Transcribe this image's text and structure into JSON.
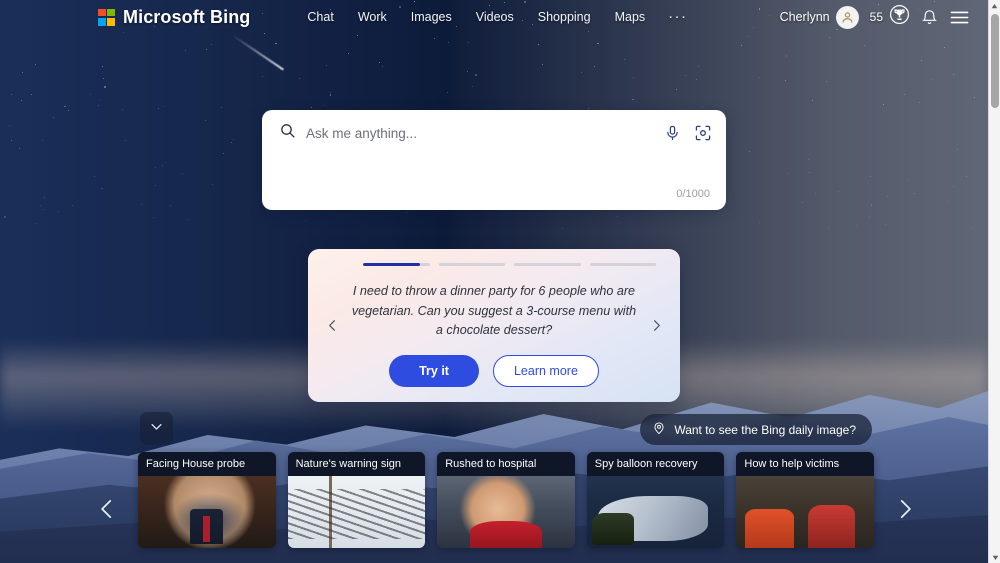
{
  "header": {
    "brand": "Microsoft Bing",
    "brand_logo_icon": "microsoft-logo-icon",
    "nav": [
      {
        "label": "Chat"
      },
      {
        "label": "Work"
      },
      {
        "label": "Images"
      },
      {
        "label": "Videos"
      },
      {
        "label": "Shopping"
      },
      {
        "label": "Maps"
      }
    ],
    "more_label": "···",
    "user_name": "Cherlynn",
    "avatar_icon": "user-avatar-icon",
    "rewards_count": "55",
    "rewards_icon": "trophy-icon",
    "notifications_icon": "bell-icon",
    "menu_icon": "hamburger-menu-icon"
  },
  "search": {
    "placeholder": "Ask me anything...",
    "value": "",
    "search_icon": "search-icon",
    "mic_icon": "microphone-icon",
    "visual_search_icon": "visual-search-icon",
    "counter": "0/1000"
  },
  "suggestion": {
    "prompt": "I need to throw a dinner party for 6 people who are vegetarian. Can you suggest a 3-course menu with a chocolate dessert?",
    "try_label": "Try it",
    "learn_label": "Learn more",
    "prev_icon": "chevron-left-icon",
    "next_icon": "chevron-right-icon",
    "progress": [
      85,
      0,
      0,
      0
    ],
    "active_color": "#1f2fa8",
    "inactive_color": "#d4d2d8"
  },
  "daily_image": {
    "label": "Want to see the Bing daily image?",
    "pin_icon": "location-pin-icon"
  },
  "collapse": {
    "icon": "chevron-down-icon"
  },
  "news": {
    "prev_icon": "chevron-left-icon",
    "next_icon": "chevron-right-icon",
    "cards": [
      {
        "title": "Facing House probe",
        "art": "ph1"
      },
      {
        "title": "Nature's warning sign",
        "art": "ph2"
      },
      {
        "title": "Rushed to hospital",
        "art": "ph3"
      },
      {
        "title": "Spy balloon recovery",
        "art": "ph4"
      },
      {
        "title": "How to help victims",
        "art": "ph5"
      }
    ]
  },
  "scrollbar": {
    "up_icon": "scroll-up-arrow-icon",
    "down_icon": "scroll-down-arrow-icon"
  },
  "theme": {
    "accent_blue": "#2f4ce0",
    "sky_top": "#0b1630",
    "sunset_pink": "#f0c3b8",
    "mountain_blue": "#3a4c78"
  }
}
